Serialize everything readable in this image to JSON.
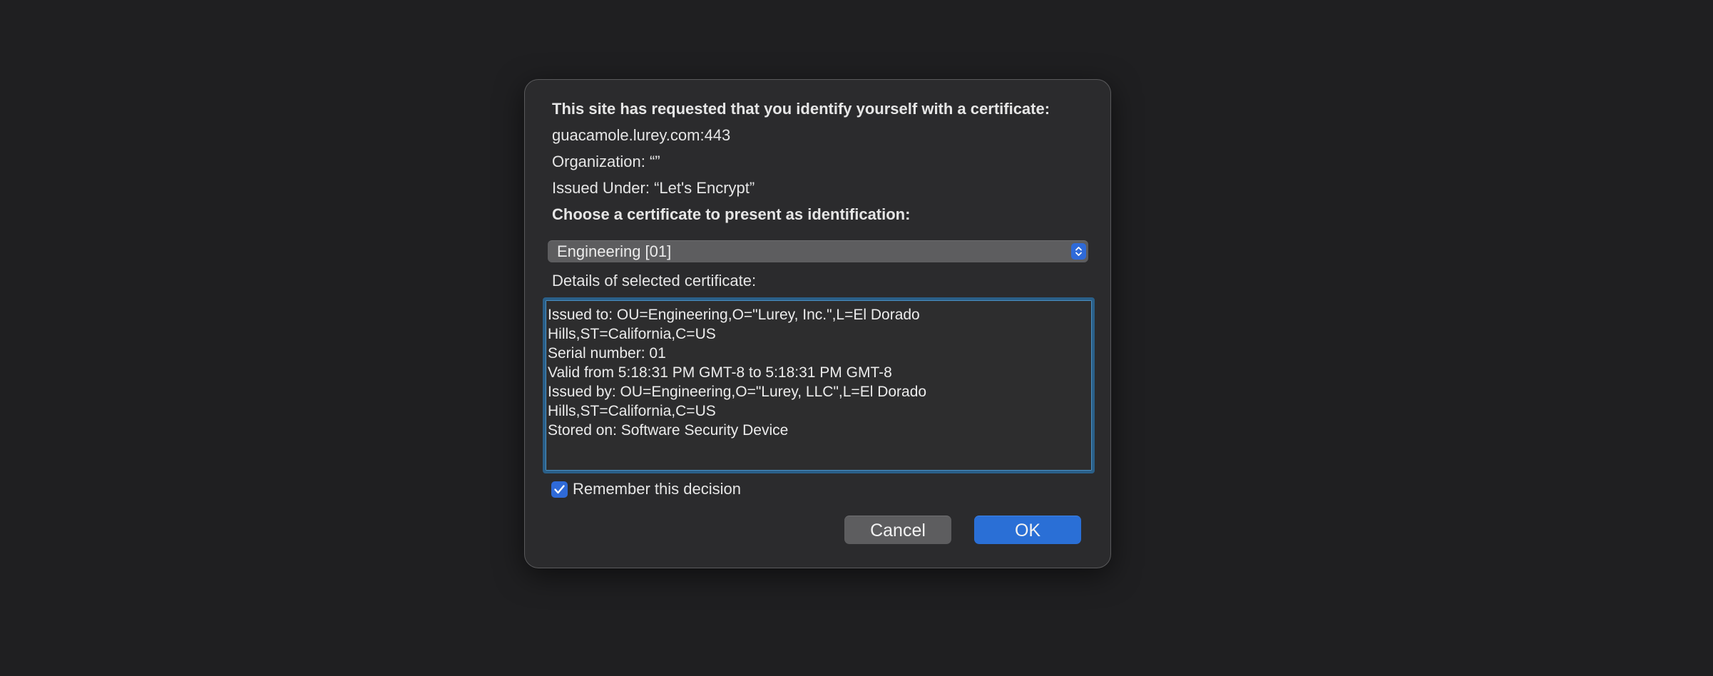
{
  "dialog": {
    "prompt": "This site has requested that you identify yourself with a certificate:",
    "host": "guacamole.lurey.com:443",
    "organization": "Organization: “”",
    "issued_under": "Issued Under: “Let's Encrypt”",
    "choose_label": "Choose a certificate to present as identification:",
    "certificate_select": {
      "selected": "Engineering [01]"
    },
    "details_label": "Details of selected certificate:",
    "details_lines": [
      "Issued to: OU=Engineering,O=\"Lurey, Inc.\",L=El Dorado",
      "Hills,ST=California,C=US",
      "Serial number: 01",
      "Valid from 5:18:31 PM GMT-8 to 5:18:31 PM GMT-8",
      "Issued by: OU=Engineering,O=\"Lurey, LLC\",L=El Dorado",
      "Hills,ST=California,C=US",
      "Stored on: Software Security Device"
    ],
    "remember": {
      "label": "Remember this decision",
      "checked": true
    },
    "buttons": {
      "cancel": "Cancel",
      "ok": "OK"
    }
  },
  "icons": {
    "select_stepper": "up-down-chevron-icon",
    "checkbox": "checkmark-icon"
  },
  "colors": {
    "background": "#1f1f21",
    "dialog": "#2b2b2d",
    "accent": "#2a6fd6",
    "focus_ring": "#2a5f88"
  }
}
